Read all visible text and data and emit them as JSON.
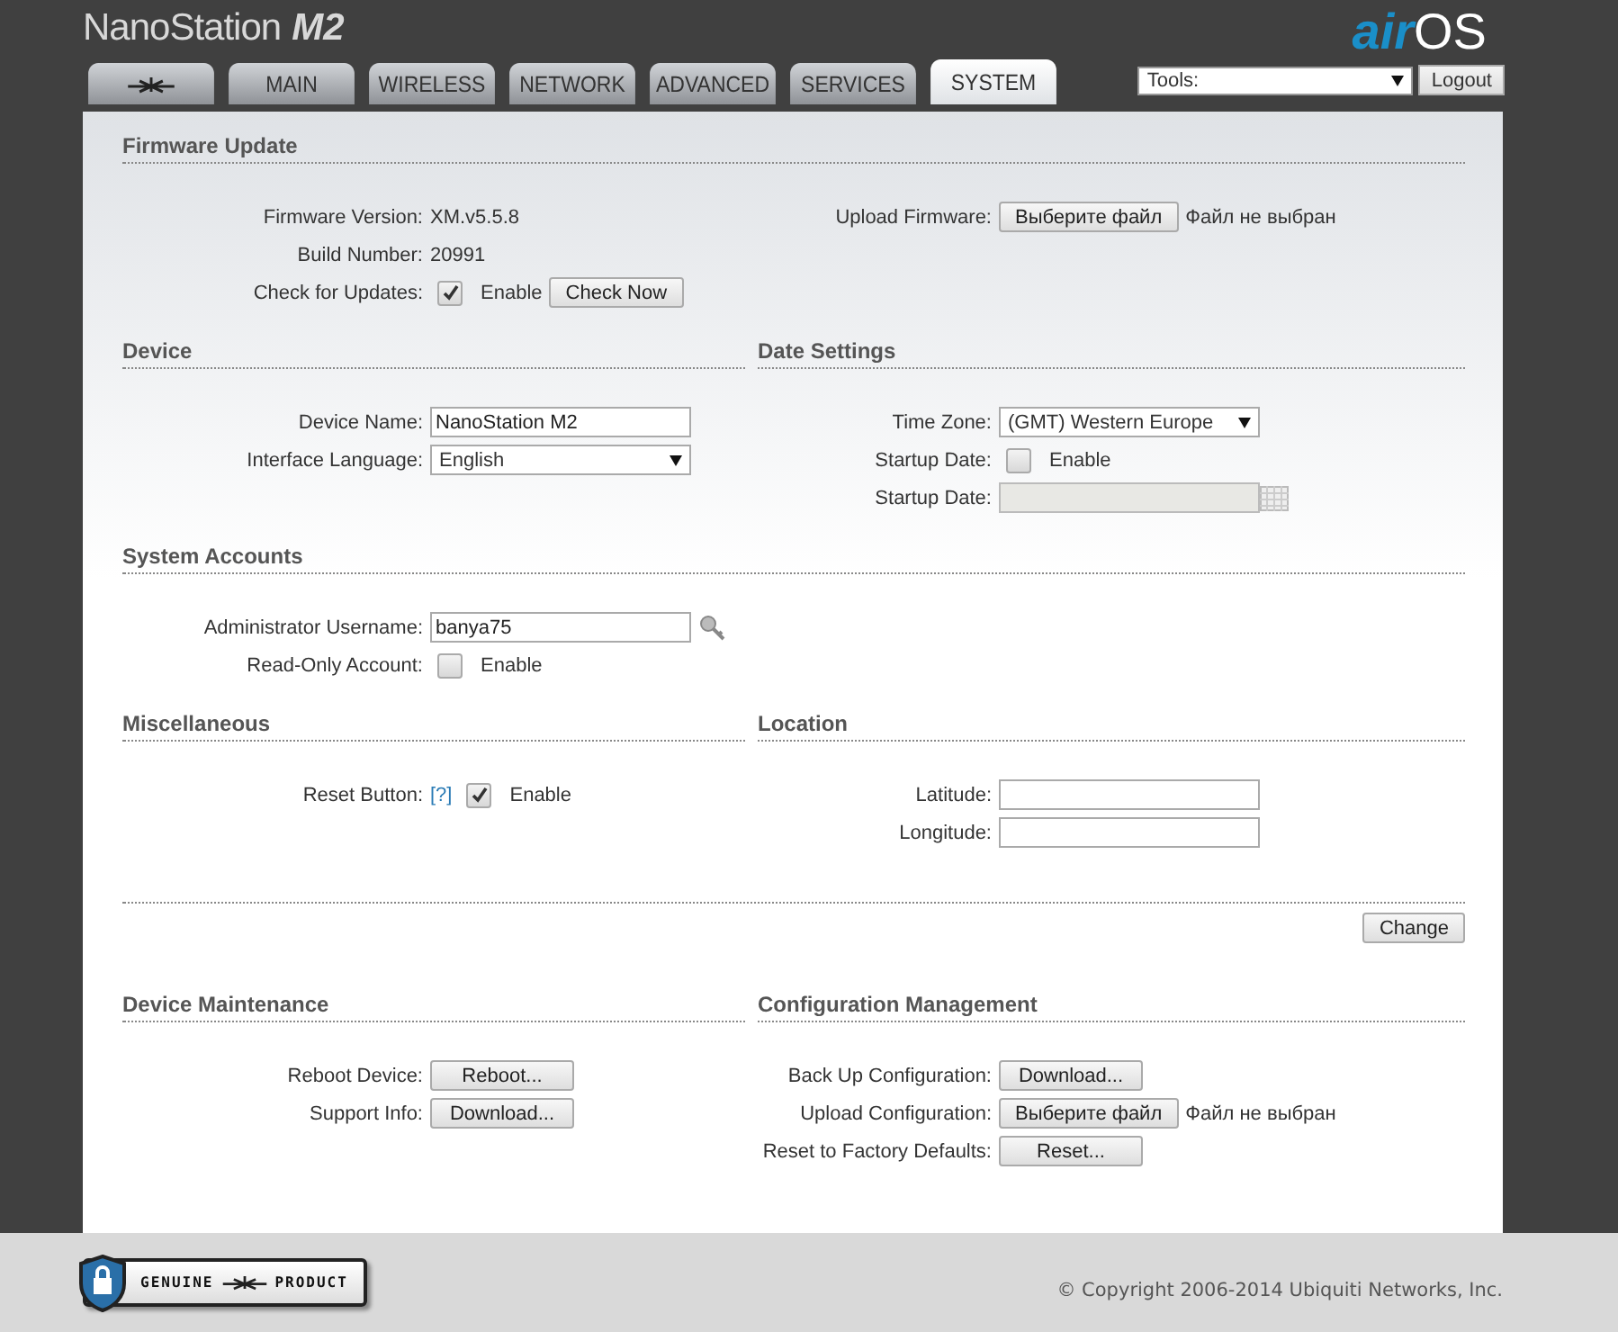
{
  "header": {
    "product": "NanoStation",
    "model": "M2",
    "brand_air": "air",
    "brand_os": "OS"
  },
  "tabs": [
    {
      "kind": "icon",
      "selected": false
    },
    {
      "kind": "text",
      "label": "MAIN",
      "selected": false
    },
    {
      "kind": "text",
      "label": "WIRELESS",
      "selected": false
    },
    {
      "kind": "text",
      "label": "NETWORK",
      "selected": false
    },
    {
      "kind": "text",
      "label": "ADVANCED",
      "selected": false
    },
    {
      "kind": "text",
      "label": "SERVICES",
      "selected": false
    },
    {
      "kind": "text",
      "label": "SYSTEM",
      "selected": true
    }
  ],
  "tools": {
    "value": "Tools:",
    "logout": "Logout"
  },
  "bands": [
    {
      "kind": "section",
      "title": "Firmware Update",
      "columns": [
        {
          "fields": [
            {
              "kind": "text",
              "label": "Firmware Version:",
              "value": "XM.v5.5.8"
            },
            {
              "kind": "text",
              "label": "Build Number:",
              "value": "20991"
            },
            {
              "kind": "checkbox",
              "label": "Check for Updates:",
              "checked": true,
              "text": "Enable",
              "button": "Check Now"
            }
          ]
        },
        {
          "fields": [
            {
              "kind": "file",
              "label": "Upload Firmware:",
              "button": "Выберите файл",
              "status": "Файл не выбран"
            }
          ]
        }
      ]
    },
    {
      "kind": "section",
      "columns": [
        {
          "title": "Device",
          "fields": [
            {
              "kind": "input",
              "label": "Device Name:",
              "value": "NanoStation M2"
            },
            {
              "kind": "select",
              "label": "Interface Language:",
              "value": "English"
            }
          ]
        },
        {
          "title": "Date Settings",
          "fields": [
            {
              "kind": "select",
              "label": "Time Zone:",
              "value": "(GMT) Western Europe"
            },
            {
              "kind": "checkbox",
              "label": "Startup Date:",
              "checked": false,
              "text": "Enable"
            },
            {
              "kind": "date",
              "label": "Startup Date:",
              "disabled": true
            }
          ]
        }
      ]
    },
    {
      "kind": "section",
      "title": "System Accounts",
      "columns": [
        {
          "fields": [
            {
              "kind": "input",
              "label": "Administrator Username:",
              "value": "banya75",
              "key": true
            },
            {
              "kind": "checkbox",
              "label": "Read-Only Account:",
              "checked": false,
              "text": "Enable"
            }
          ]
        }
      ]
    },
    {
      "kind": "section",
      "columns": [
        {
          "title": "Miscellaneous",
          "fields": [
            {
              "kind": "checkbox",
              "label": "Reset Button:",
              "help": "[?]",
              "checked": true,
              "text": "Enable"
            }
          ]
        },
        {
          "title": "Location",
          "fields": [
            {
              "kind": "input",
              "label": "Latitude:"
            },
            {
              "kind": "input",
              "label": "Longitude:"
            }
          ]
        }
      ]
    },
    {
      "kind": "action",
      "button": "Change"
    },
    {
      "kind": "section",
      "columns": [
        {
          "title": "Device Maintenance",
          "fields": [
            {
              "kind": "button",
              "label": "Reboot Device:",
              "button": "Reboot..."
            },
            {
              "kind": "button",
              "label": "Support Info:",
              "button": "Download..."
            }
          ]
        },
        {
          "title": "Configuration Management",
          "fields": [
            {
              "kind": "button",
              "label": "Back Up Configuration:",
              "button": "Download..."
            },
            {
              "kind": "file",
              "label": "Upload Configuration:",
              "button": "Выберите файл",
              "status": "Файл не выбран"
            },
            {
              "kind": "button",
              "label": "Reset to Factory Defaults:",
              "button": "Reset..."
            }
          ]
        }
      ]
    }
  ],
  "footer": {
    "badge_left": "GENUINE",
    "badge_right": "PRODUCT",
    "copyright": "© Copyright 2006-2014 Ubiquiti Networks, Inc."
  }
}
